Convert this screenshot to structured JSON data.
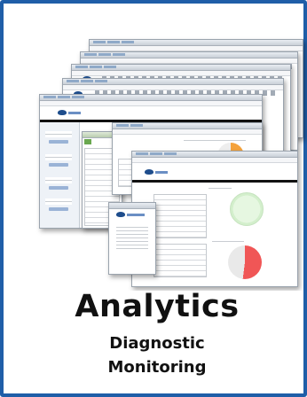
{
  "caption": {
    "title": "Analytics",
    "line2": "Diagnostic",
    "line3": "Monitoring"
  },
  "colors": {
    "border": "#1f5ea8",
    "pie_green": "#d9f2d4",
    "pie_red": "#f05656",
    "pie_orange": "#f4a23c",
    "brand_blue": "#1e4d8c"
  },
  "icons": [
    "browser-window-icon",
    "company-logo-icon",
    "pie-chart-icon"
  ]
}
